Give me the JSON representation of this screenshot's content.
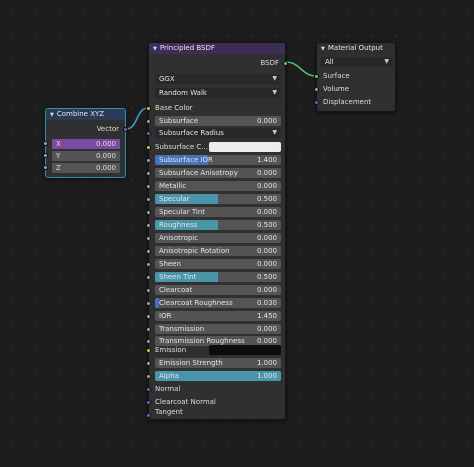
{
  "colors": {
    "editor_bg": "#1d1d1d",
    "node_body": "#303030",
    "shader_header": "#3b2f55",
    "vector_header": "#2b3b57",
    "output_header": "#2e2e2e",
    "field_fill": "#4772b3",
    "field_fill_cyan": "#4a96a8",
    "socket_grey": "#a1a1a1",
    "socket_yellow": "#c7c729",
    "socket_purple": "#6363c7",
    "socket_green": "#63c763",
    "wire": "#3d9ad1",
    "wire_shader": "#4fc06f"
  },
  "combine_xyz": {
    "title": "Combine XYZ",
    "output": "Vector",
    "inputs": [
      {
        "label": "X",
        "value": "0.000"
      },
      {
        "label": "Y",
        "value": "0.000"
      },
      {
        "label": "Z",
        "value": "0.000"
      }
    ]
  },
  "bsdf": {
    "title": "Principled BSDF",
    "output": "BSDF",
    "distribution": "GGX",
    "subsurface_method": "Random Walk",
    "base_color_label": "Base Color",
    "subsurface_radius_label": "Subsurface Radius",
    "subsurface_color_label": "Subsurface C...",
    "emission_label": "Emission",
    "normal_label": "Normal",
    "clearcoat_normal_label": "Clearcoat Normal",
    "tangent_label": "Tangent",
    "fields": [
      {
        "label": "Subsurface",
        "value": "0.000",
        "fill": 0.0
      },
      {
        "label": "Subsurface IOR",
        "value": "1.400",
        "fill": 0.42
      },
      {
        "label": "Subsurface Anisotropy",
        "value": "0.000",
        "fill": 0.0
      },
      {
        "label": "Metallic",
        "value": "0.000",
        "fill": 0.0
      },
      {
        "label": "Specular",
        "value": "0.500",
        "fill": 0.5
      },
      {
        "label": "Specular Tint",
        "value": "0.000",
        "fill": 0.0
      },
      {
        "label": "Roughness",
        "value": "0.500",
        "fill": 0.5
      },
      {
        "label": "Anisotropic",
        "value": "0.000",
        "fill": 0.0
      },
      {
        "label": "Anisotropic Rotation",
        "value": "0.000",
        "fill": 0.0
      },
      {
        "label": "Sheen",
        "value": "0.000",
        "fill": 0.0
      },
      {
        "label": "Sheen Tint",
        "value": "0.500",
        "fill": 0.5
      },
      {
        "label": "Clearcoat",
        "value": "0.000",
        "fill": 0.0
      },
      {
        "label": "Clearcoat Roughness",
        "value": "0.030",
        "fill": 0.03
      },
      {
        "label": "IOR",
        "value": "1.450",
        "fill": 0.0
      },
      {
        "label": "Transmission",
        "value": "0.000",
        "fill": 0.0
      },
      {
        "label": "Transmission Roughness",
        "value": "0.000",
        "fill": 0.0
      }
    ],
    "emission_strength": {
      "label": "Emission Strength",
      "value": "1.000",
      "fill": 0.0
    },
    "alpha": {
      "label": "Alpha",
      "value": "1.000",
      "fill": 1.0
    }
  },
  "material_output": {
    "title": "Material Output",
    "target": "All",
    "inputs": [
      "Surface",
      "Volume",
      "Displacement"
    ]
  }
}
